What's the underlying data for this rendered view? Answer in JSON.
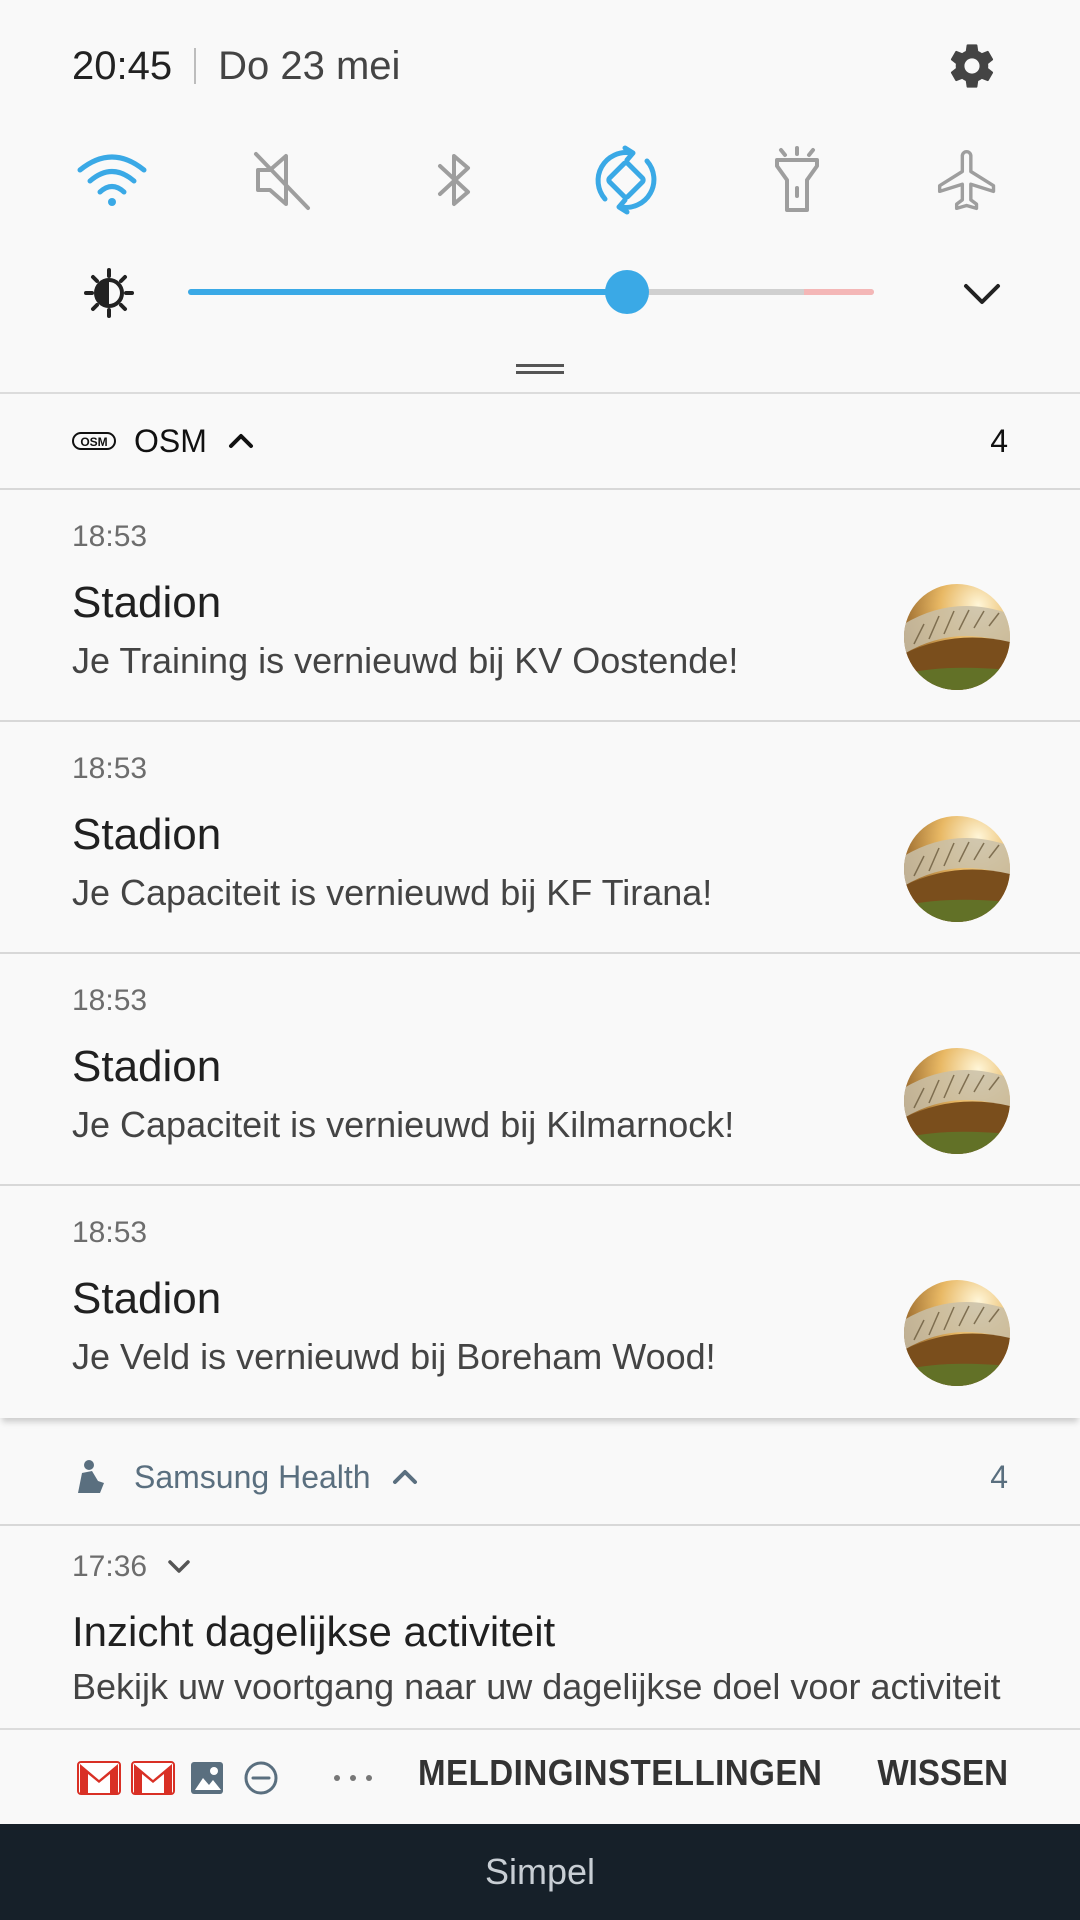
{
  "status": {
    "time": "20:45",
    "date": "Do 23 mei"
  },
  "quick_toggles": [
    {
      "name": "wifi-icon",
      "active": true
    },
    {
      "name": "mute-icon",
      "active": false
    },
    {
      "name": "bluetooth-icon",
      "active": false
    },
    {
      "name": "auto-rotate-icon",
      "active": true
    },
    {
      "name": "flashlight-icon",
      "active": false
    },
    {
      "name": "airplane-mode-icon",
      "active": false
    }
  ],
  "brightness": {
    "level": 0.64
  },
  "colors": {
    "accent": "#3aa9e6",
    "inactive": "#9e9e9e",
    "navbar": "#162029"
  },
  "osm_group": {
    "app_name": "OSM",
    "icon_text": "OSM",
    "count": "4",
    "notifications": [
      {
        "time": "18:53",
        "title": "Stadion",
        "text": "Je Training is vernieuwd bij KV Oostende!"
      },
      {
        "time": "18:53",
        "title": "Stadion",
        "text": "Je Capaciteit is vernieuwd bij KF Tirana!"
      },
      {
        "time": "18:53",
        "title": "Stadion",
        "text": "Je Capaciteit is vernieuwd bij Kilmarnock!"
      },
      {
        "time": "18:53",
        "title": "Stadion",
        "text": "Je Veld is vernieuwd bij Boreham Wood!"
      }
    ]
  },
  "health_group": {
    "app_name": "Samsung Health",
    "count": "4",
    "notification": {
      "time": "17:36",
      "title": "Inzicht dagelijkse activiteit",
      "text": "Bekijk uw voortgang naar uw dagelijkse doel voor activiteit"
    }
  },
  "actions": {
    "tray": [
      "gmail-icon",
      "gmail-icon",
      "image-icon",
      "do-not-disturb-icon"
    ],
    "notification_settings": "MELDINGINSTELLINGEN",
    "clear": "WISSEN"
  },
  "navbar": {
    "label": "Simpel"
  }
}
